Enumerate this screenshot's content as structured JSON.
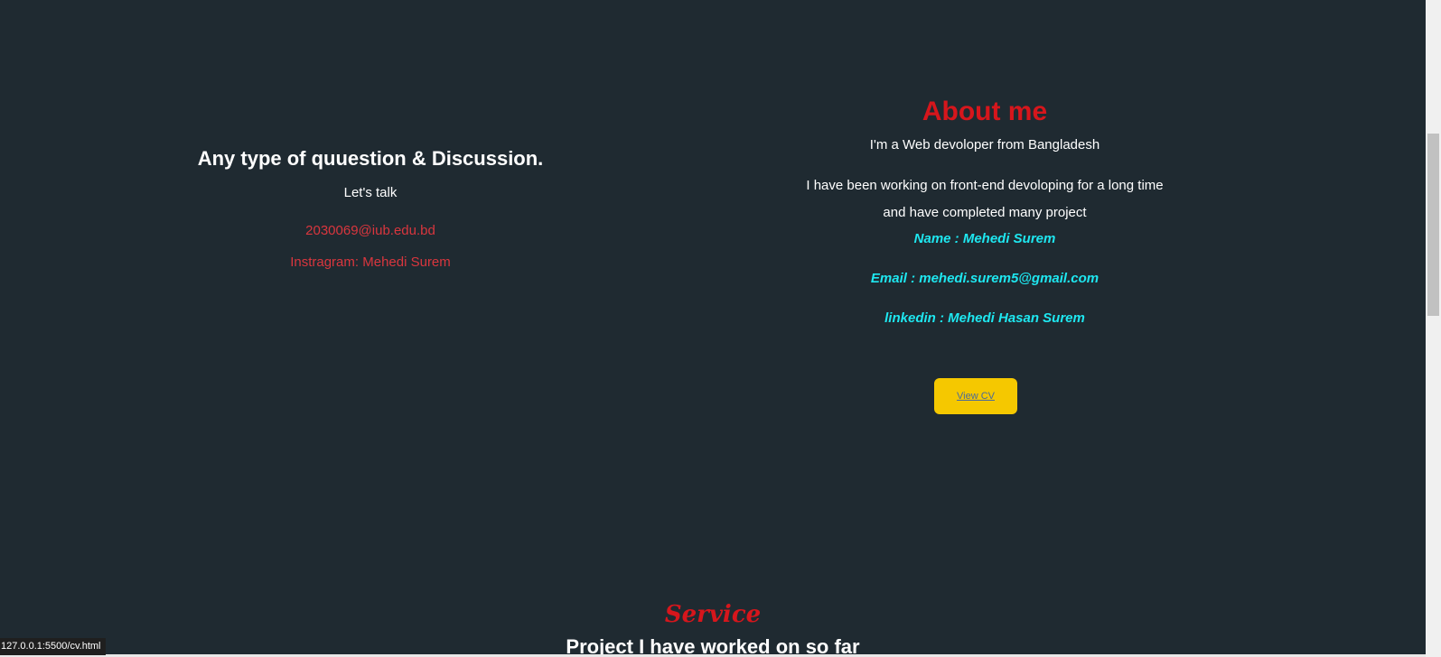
{
  "discussion": {
    "heading": "Any type of quuestion & Discussion.",
    "subheading": "Let's talk",
    "email": "2030069@iub.edu.bd",
    "instagram": "Instragram: Mehedi Surem"
  },
  "about": {
    "heading": "About me",
    "intro": "I'm a Web devoloper from Bangladesh",
    "paragraph_line1": "I have been working on front-end devoloping for a long time",
    "paragraph_line2": "and have completed many project",
    "name": "Name : Mehedi Surem",
    "email": "Email : mehedi.surem5@gmail.com",
    "linkedin": "linkedin : Mehedi Hasan Surem",
    "cv_button": "View CV"
  },
  "service": {
    "title": "Service",
    "subtitle": "Project I have worked on so far"
  },
  "status_bar": {
    "url": "127.0.0.1:5500/cv.html"
  },
  "colors": {
    "background": "#1f2a31",
    "accent_red": "#d6161c",
    "contact_red": "#d9363e",
    "cyan": "#1ee7f0",
    "button_yellow": "#f5c800"
  }
}
